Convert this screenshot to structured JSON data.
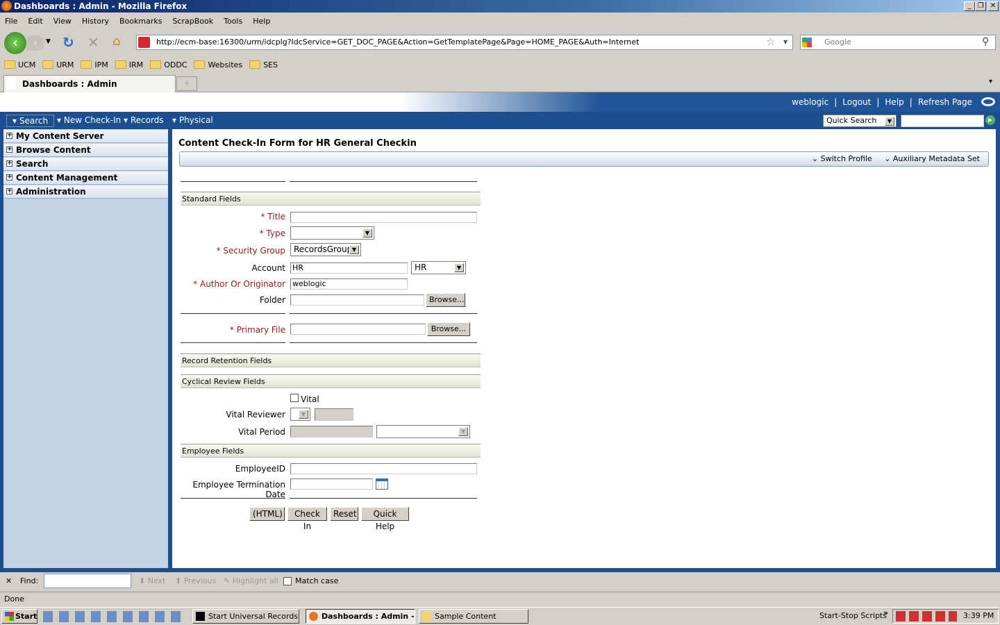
{
  "window": {
    "title": "Dashboards : Admin - Mozilla Firefox"
  },
  "menu": [
    "File",
    "Edit",
    "View",
    "History",
    "Bookmarks",
    "ScrapBook",
    "Tools",
    "Help"
  ],
  "url": "http://ecm-base:16300/urm/idcplg?IdcService=GET_DOC_PAGE&Action=GetTemplatePage&Page=HOME_PAGE&Auth=Internet",
  "search_placeholder": "Google",
  "bookmarks": [
    "UCM",
    "URM",
    "IPM",
    "IRM",
    "ODDC",
    "Websites",
    "SES"
  ],
  "tab": {
    "title": "Dashboards : Admin"
  },
  "header_links": [
    "weblogic",
    "|",
    "Logout",
    "|",
    "Help",
    "|",
    "Refresh Page"
  ],
  "nav": [
    "Search",
    "New Check-In",
    "Records",
    "Physical"
  ],
  "quick_search": {
    "selected": "Quick Search",
    "value": ""
  },
  "sidebar": [
    "My Content Server",
    "Browse Content",
    "Search",
    "Content Management",
    "Administration"
  ],
  "page_title": "Content Check-In Form for HR General Checkin",
  "actions": [
    "Switch Profile",
    "Auxiliary Metadata Set"
  ],
  "sections": {
    "standard": "Standard Fields",
    "retention": "Record Retention Fields",
    "cyclical": "Cyclical Review Fields",
    "employee": "Employee Fields"
  },
  "fields": {
    "title": {
      "label": "* Title",
      "value": ""
    },
    "type": {
      "label": "* Type",
      "value": ""
    },
    "security_group": {
      "label": "* Security Group",
      "value": "RecordsGroup"
    },
    "account": {
      "label": "Account",
      "value": "HR",
      "select": "HR"
    },
    "author": {
      "label": "* Author Or Originator",
      "value": "weblogic"
    },
    "folder": {
      "label": "Folder",
      "value": "",
      "browse": "Browse..."
    },
    "primary_file": {
      "label": "* Primary File",
      "value": "",
      "browse": "Browse..."
    },
    "vital": {
      "label": "Vital",
      "checked": false
    },
    "vital_reviewer": {
      "label": "Vital Reviewer"
    },
    "vital_period": {
      "label": "Vital Period"
    },
    "employee_id": {
      "label": "EmployeeID",
      "value": ""
    },
    "termination_date": {
      "label": "Employee Termination Date",
      "value": ""
    }
  },
  "buttons": [
    "(HTML)",
    "Check In",
    "Reset",
    "Quick Help"
  ],
  "find": {
    "label": "Find:",
    "next": "Next",
    "previous": "Previous",
    "highlight": "Highlight all",
    "match_case": "Match case"
  },
  "status": "Done",
  "taskbar": {
    "start": "Start",
    "tasks": [
      "Start Universal Records ...",
      "Dashboards : Admin - ...",
      "Sample Content"
    ],
    "toolbar": "Start-Stop Scripts",
    "clock": "3:39 PM"
  }
}
